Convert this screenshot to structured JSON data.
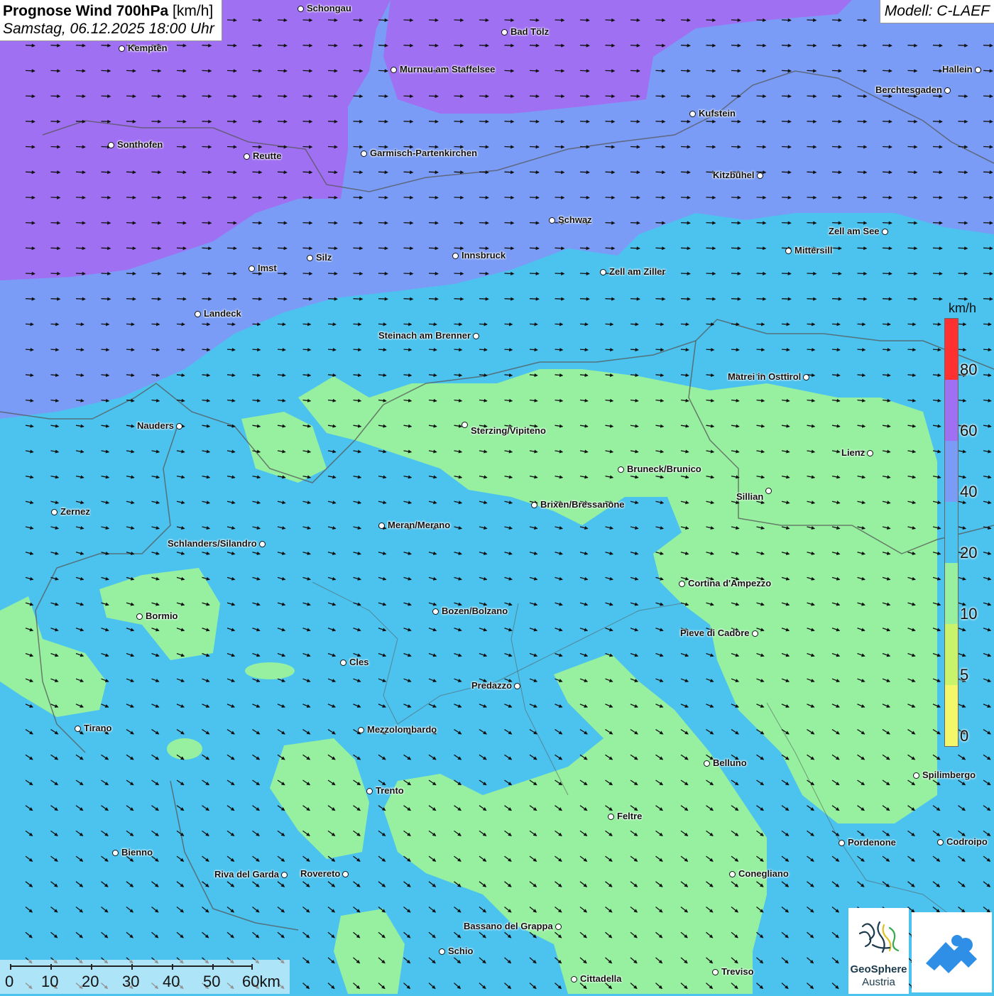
{
  "header": {
    "title_bold": "Prognose Wind 700hPa",
    "title_unit": "[km/h]",
    "date": "Samstag, 06.12.2025 18:00 Uhr",
    "model": "Modell: C-LAEF"
  },
  "colors": {
    "band_0": "#f4f76a",
    "band_5": "#c8f36a",
    "band_10": "#96f0a0",
    "band_20": "#4cc3ee",
    "band_40": "#7a9cf6",
    "band_60": "#a070f2",
    "band_80": "#ff3030",
    "borders": "#555555",
    "arrows": "#111111"
  },
  "legend": {
    "unit": "km/h",
    "ticks": [
      "80",
      "60",
      "40",
      "20",
      "10",
      "5",
      "0"
    ]
  },
  "cities": [
    {
      "name": "Schongau"
    },
    {
      "name": "Bad Tölz"
    },
    {
      "name": "Kempten"
    },
    {
      "name": "Murnau am Staffelsee"
    },
    {
      "name": "Hallein"
    },
    {
      "name": "Berchtesgaden"
    },
    {
      "name": "Kufstein"
    },
    {
      "name": "Sonthofen"
    },
    {
      "name": "Reutte"
    },
    {
      "name": "Garmisch-Partenkirchen"
    },
    {
      "name": "Kitzbühel"
    },
    {
      "name": "Schwaz"
    },
    {
      "name": "Zell am See"
    },
    {
      "name": "Innsbruck"
    },
    {
      "name": "Silz"
    },
    {
      "name": "Mittersill"
    },
    {
      "name": "Imst"
    },
    {
      "name": "Zell am Ziller"
    },
    {
      "name": "Landeck"
    },
    {
      "name": "Steinach am Brenner"
    },
    {
      "name": "Matrei in Osttirol"
    },
    {
      "name": "Nauders"
    },
    {
      "name": "Sterzing/Vipiteno"
    },
    {
      "name": "Lienz"
    },
    {
      "name": "Bruneck/Brunico"
    },
    {
      "name": "Sillian"
    },
    {
      "name": "Brixen/Bressanone"
    },
    {
      "name": "Zernez"
    },
    {
      "name": "Meran/Merano"
    },
    {
      "name": "Schlanders/Silandro"
    },
    {
      "name": "Cortina d'Ampezzo"
    },
    {
      "name": "Bozen/Bolzano"
    },
    {
      "name": "Bormio"
    },
    {
      "name": "Pieve di Cadore"
    },
    {
      "name": "Cles"
    },
    {
      "name": "Predazzo"
    },
    {
      "name": "Tirano"
    },
    {
      "name": "Mezzolombardo"
    },
    {
      "name": "Belluno"
    },
    {
      "name": "Spilimbergo"
    },
    {
      "name": "Trento"
    },
    {
      "name": "Feltre"
    },
    {
      "name": "Pordenone"
    },
    {
      "name": "Codroipo"
    },
    {
      "name": "Bienno"
    },
    {
      "name": "Riva del Garda"
    },
    {
      "name": "Rovereto"
    },
    {
      "name": "Conegliano"
    },
    {
      "name": "Bassano del Grappa"
    },
    {
      "name": "Schio"
    },
    {
      "name": "Treviso"
    },
    {
      "name": "Cittadella"
    }
  ],
  "scalebar": {
    "labels": [
      "0",
      "10",
      "20",
      "30",
      "40",
      "50",
      "60km"
    ]
  },
  "logo": {
    "line1": "GeoSphere",
    "line2": "Austria"
  }
}
